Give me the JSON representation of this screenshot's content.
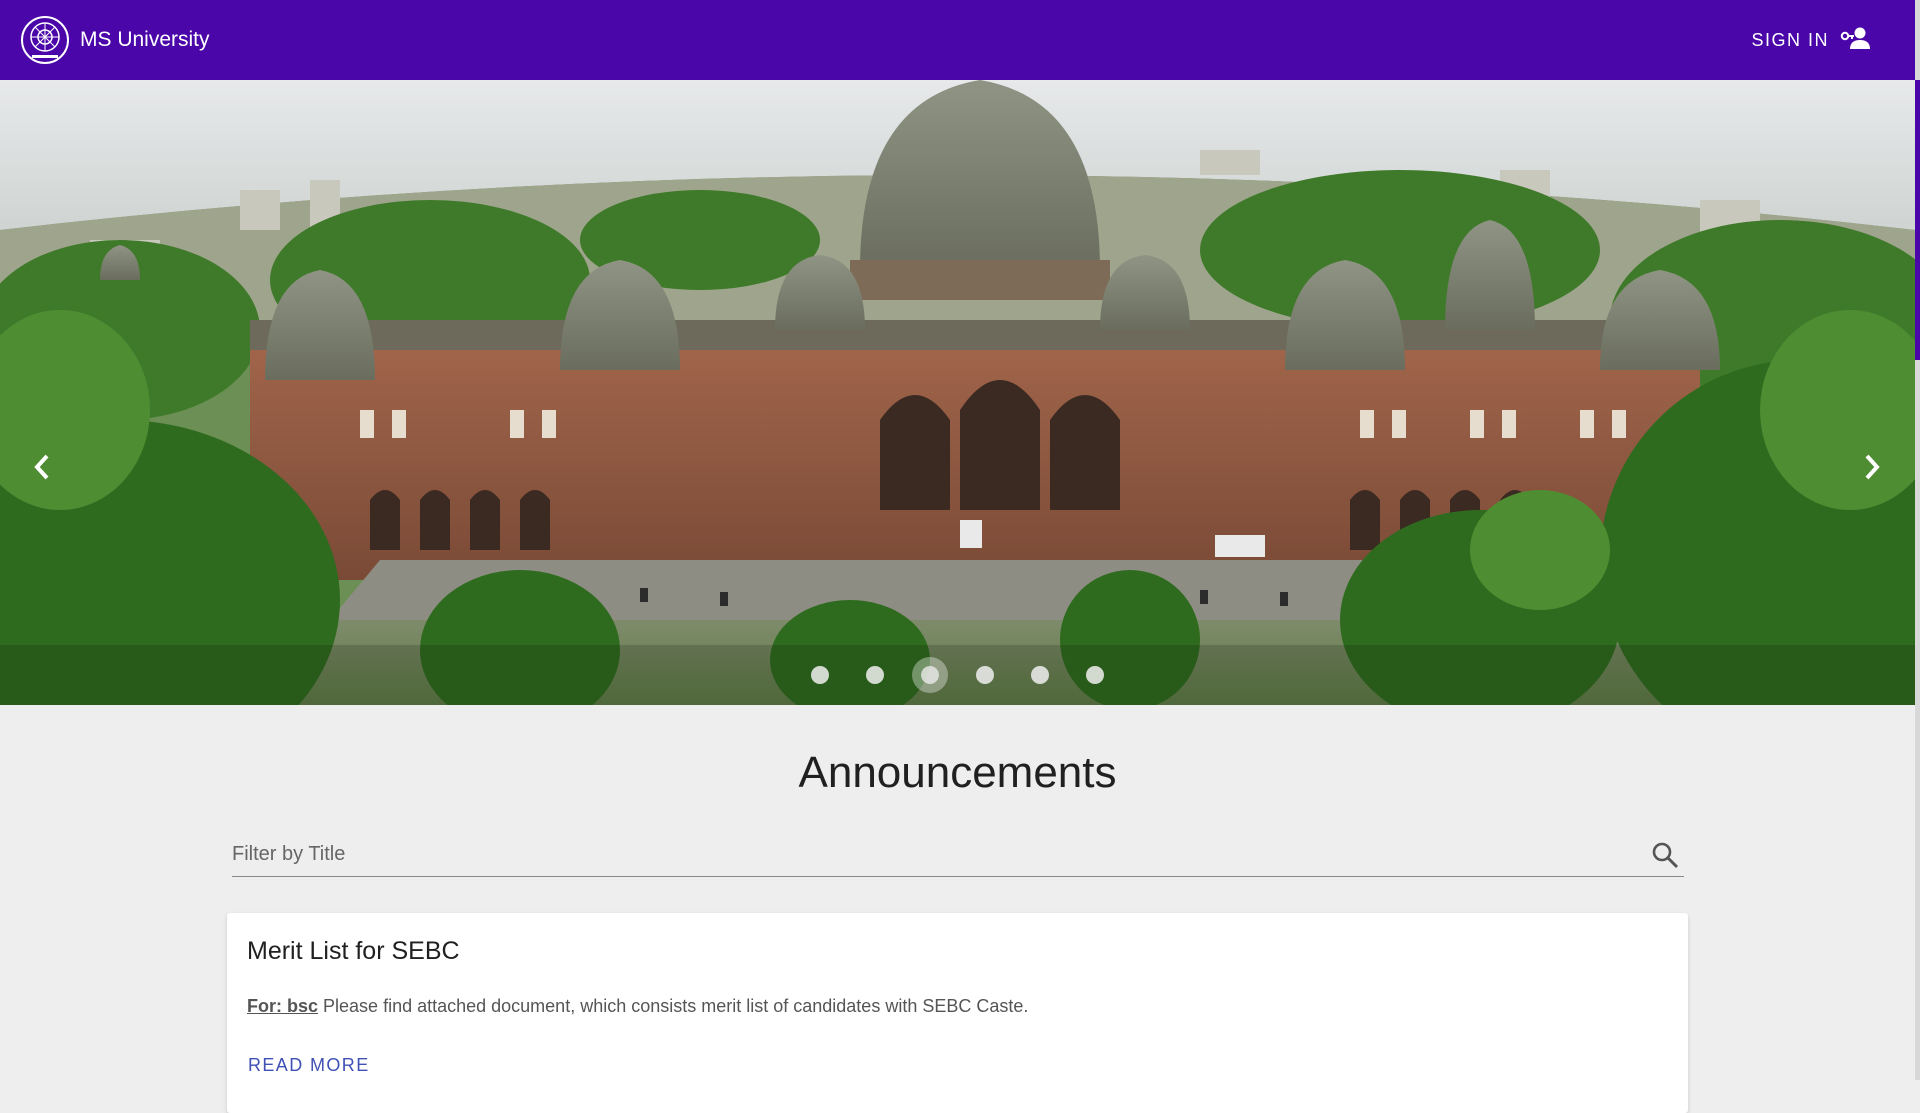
{
  "header": {
    "brand": "MS University",
    "signin_label": "SIGN IN",
    "logo_icon": "university-seal-icon",
    "signin_icon": "person-key-icon",
    "background": "#4a06a8"
  },
  "carousel": {
    "slide_count": 6,
    "active_index": 2,
    "prev_icon": "chevron-left-icon",
    "next_icon": "chevron-right-icon"
  },
  "announcements": {
    "title": "Announcements",
    "filter_placeholder": "Filter by Title",
    "search_icon": "search-icon",
    "items": [
      {
        "title": "Merit List for SEBC",
        "for_label": "For: bsc",
        "body": "Please find attached document, which consists merit list of candidates with SEBC Caste.",
        "action": "READ MORE"
      }
    ]
  },
  "colors": {
    "accent": "#4a06a8",
    "link": "#3f51b5",
    "page_background": "#eeeeee"
  }
}
